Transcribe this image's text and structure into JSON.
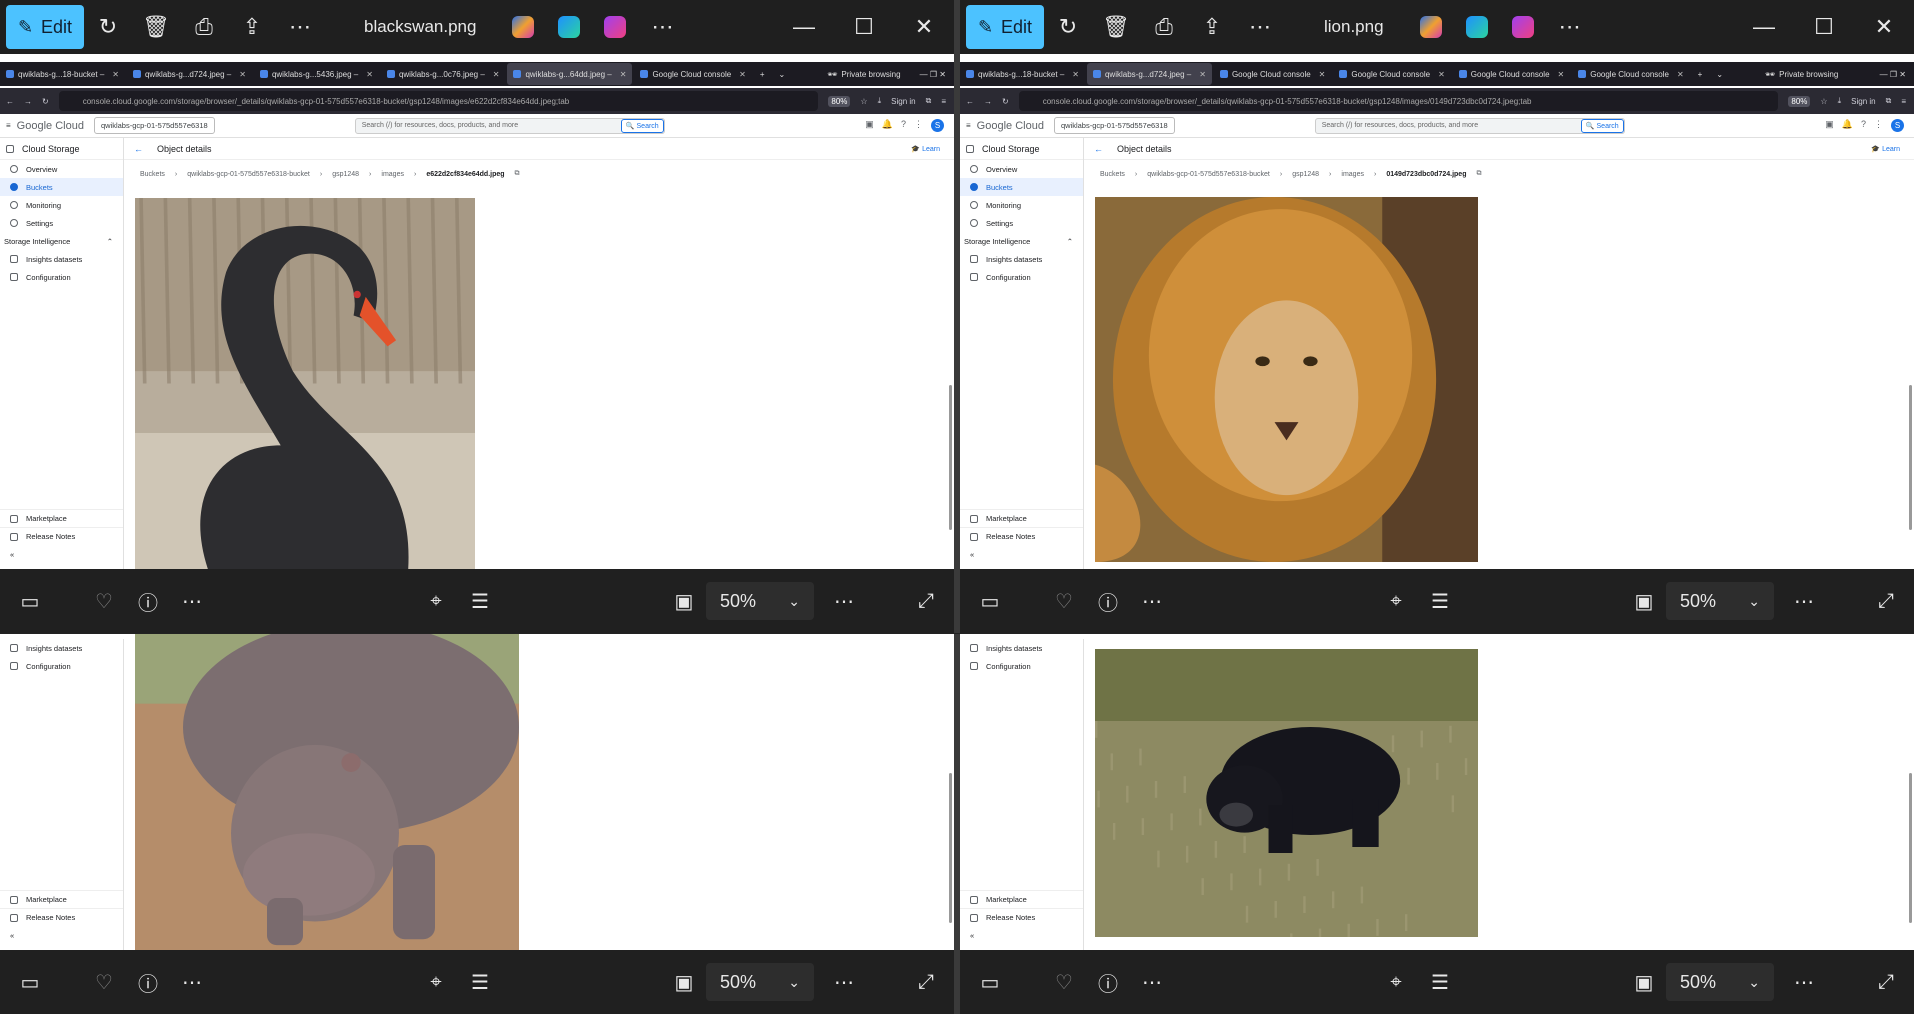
{
  "windows": [
    {
      "title": "blackswan.png",
      "edit_label": "Edit",
      "tabs": [
        "qwiklabs-g...18-bucket –",
        "qwiklabs-g...d724.jpeg –",
        "qwiklabs-g...5436.jpeg –",
        "qwiklabs-g...0c76.jpeg –",
        "qwiklabs-g...64dd.jpeg –",
        "Google Cloud console"
      ],
      "active_tab": 4,
      "private_label": "Private browsing",
      "url": "console.cloud.google.com/storage/browser/_details/qwiklabs-gcp-01-575d557e6318-bucket/gsp1248/images/e622d2cf834e64dd.jpeg;tab",
      "zoom": "80%",
      "sign_in": "Sign in",
      "breadcrumb": [
        "Buckets",
        "qwiklabs-gcp-01-575d557e6318-bucket",
        "gsp1248",
        "images"
      ],
      "object_name": "e622d2cf834e64dd.jpeg",
      "lower_image": "hippo"
    },
    {
      "title": "lion.png",
      "edit_label": "Edit",
      "tabs": [
        "qwiklabs-g...18-bucket –",
        "qwiklabs-g...d724.jpeg –",
        "Google Cloud console",
        "Google Cloud console",
        "Google Cloud console",
        "Google Cloud console"
      ],
      "active_tab": 1,
      "private_label": "Private browsing",
      "url": "console.cloud.google.com/storage/browser/_details/qwiklabs-gcp-01-575d557e6318-bucket/gsp1248/images/0149d723dbc0d724.jpeg;tab",
      "zoom": "80%",
      "sign_in": "Sign in",
      "breadcrumb": [
        "Buckets",
        "qwiklabs-gcp-01-575d557e6318-bucket",
        "gsp1248",
        "images"
      ],
      "object_name": "0149d723dbc0d724.jpeg",
      "lower_image": "bear"
    }
  ],
  "gc": {
    "logo": "Google Cloud",
    "project": "qwiklabs-gcp-01-575d557e6318",
    "search_placeholder": "Search (/) for resources, docs, products, and more",
    "search_button": "Search",
    "product": "Cloud Storage",
    "page_title": "Object details",
    "learn": "Learn",
    "avatar": "S",
    "nav": [
      "Overview",
      "Buckets",
      "Monitoring",
      "Settings"
    ],
    "section": "Storage Intelligence",
    "section_items": [
      "Insights datasets",
      "Configuration"
    ],
    "footer_items": [
      "Marketplace",
      "Release Notes"
    ],
    "collapse": "«"
  },
  "viewer": {
    "zoom": "50%"
  },
  "colors": {
    "edit_accent": "#4cc2ff",
    "gc_blue": "#1a73e8"
  }
}
